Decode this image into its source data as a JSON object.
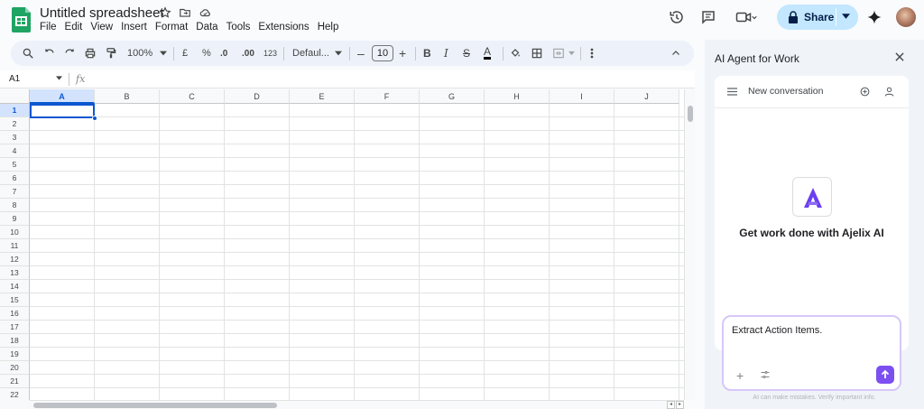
{
  "doc": {
    "title": "Untitled spreadsheet"
  },
  "menu": [
    "File",
    "Edit",
    "View",
    "Insert",
    "Format",
    "Data",
    "Tools",
    "Extensions",
    "Help"
  ],
  "header": {
    "share_label": "Share"
  },
  "toolbar": {
    "zoom": "100%",
    "currency": "£",
    "percent": "%",
    "decrease_decimal": ".0",
    "increase_decimal": ".00",
    "number_format": "123",
    "font": "Defaul...",
    "font_size": "10",
    "bold": "B",
    "italic": "I",
    "strike": "S",
    "text_color": "A"
  },
  "formula_bar": {
    "cell_ref": "A1",
    "fx": "fx"
  },
  "sheet": {
    "columns": [
      "A",
      "B",
      "C",
      "D",
      "E",
      "F",
      "G",
      "H",
      "I",
      "J"
    ],
    "rows": [
      "1",
      "2",
      "3",
      "4",
      "5",
      "6",
      "7",
      "8",
      "9",
      "10",
      "11",
      "12",
      "13",
      "14",
      "15",
      "16",
      "17",
      "18",
      "19",
      "20",
      "21",
      "22"
    ],
    "selected_column": "A",
    "selected_row": "1"
  },
  "panel": {
    "title": "AI Agent for Work",
    "conversation_label": "New conversation",
    "tagline": "Get work done with Ajelix AI",
    "input_text": "Extract Action Items.",
    "disclaimer": "AI can make mistakes. Verify important info.",
    "brand_color": "#7b4ff0"
  }
}
